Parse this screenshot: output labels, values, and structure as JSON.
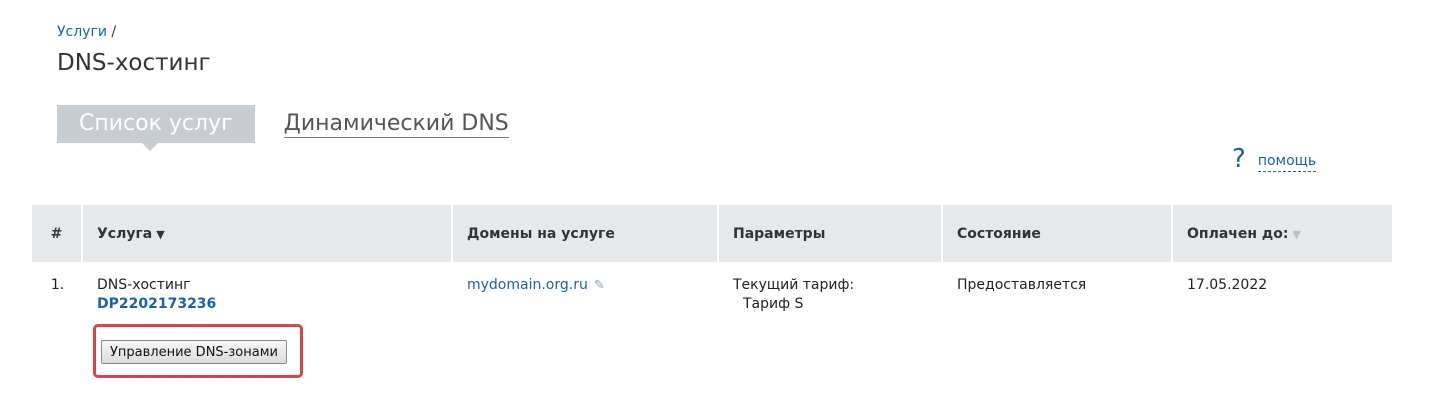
{
  "breadcrumb": {
    "link": "Услуги",
    "separator": "/"
  },
  "page_title": "DNS-хостинг",
  "tabs": [
    {
      "label": "Список услуг",
      "active": true
    },
    {
      "label": "Динамический DNS",
      "active": false
    }
  ],
  "help": {
    "icon": "?",
    "label": "помощь"
  },
  "table": {
    "headers": {
      "num": "#",
      "service": "Услуга",
      "domains": "Домены на услуге",
      "params": "Параметры",
      "status": "Состояние",
      "paid_until": "Оплачен до:"
    },
    "sort_icon": "▼",
    "rows": [
      {
        "num": "1.",
        "service_name": "DNS-хостинг",
        "service_id": "DP2202173236",
        "domain": "mydomain.org.ru",
        "tariff_label": "Текущий тариф:",
        "tariff_value": "Тариф S",
        "status": "Предоставляется",
        "paid_until": "17.05.2022",
        "action_label": "Управление DNS-зонами"
      }
    ]
  },
  "colors": {
    "link": "#1a62a8",
    "header_bg": "#e5e9ec",
    "tab_active_bg": "#c7cdd2",
    "highlight": "#d9434a"
  }
}
